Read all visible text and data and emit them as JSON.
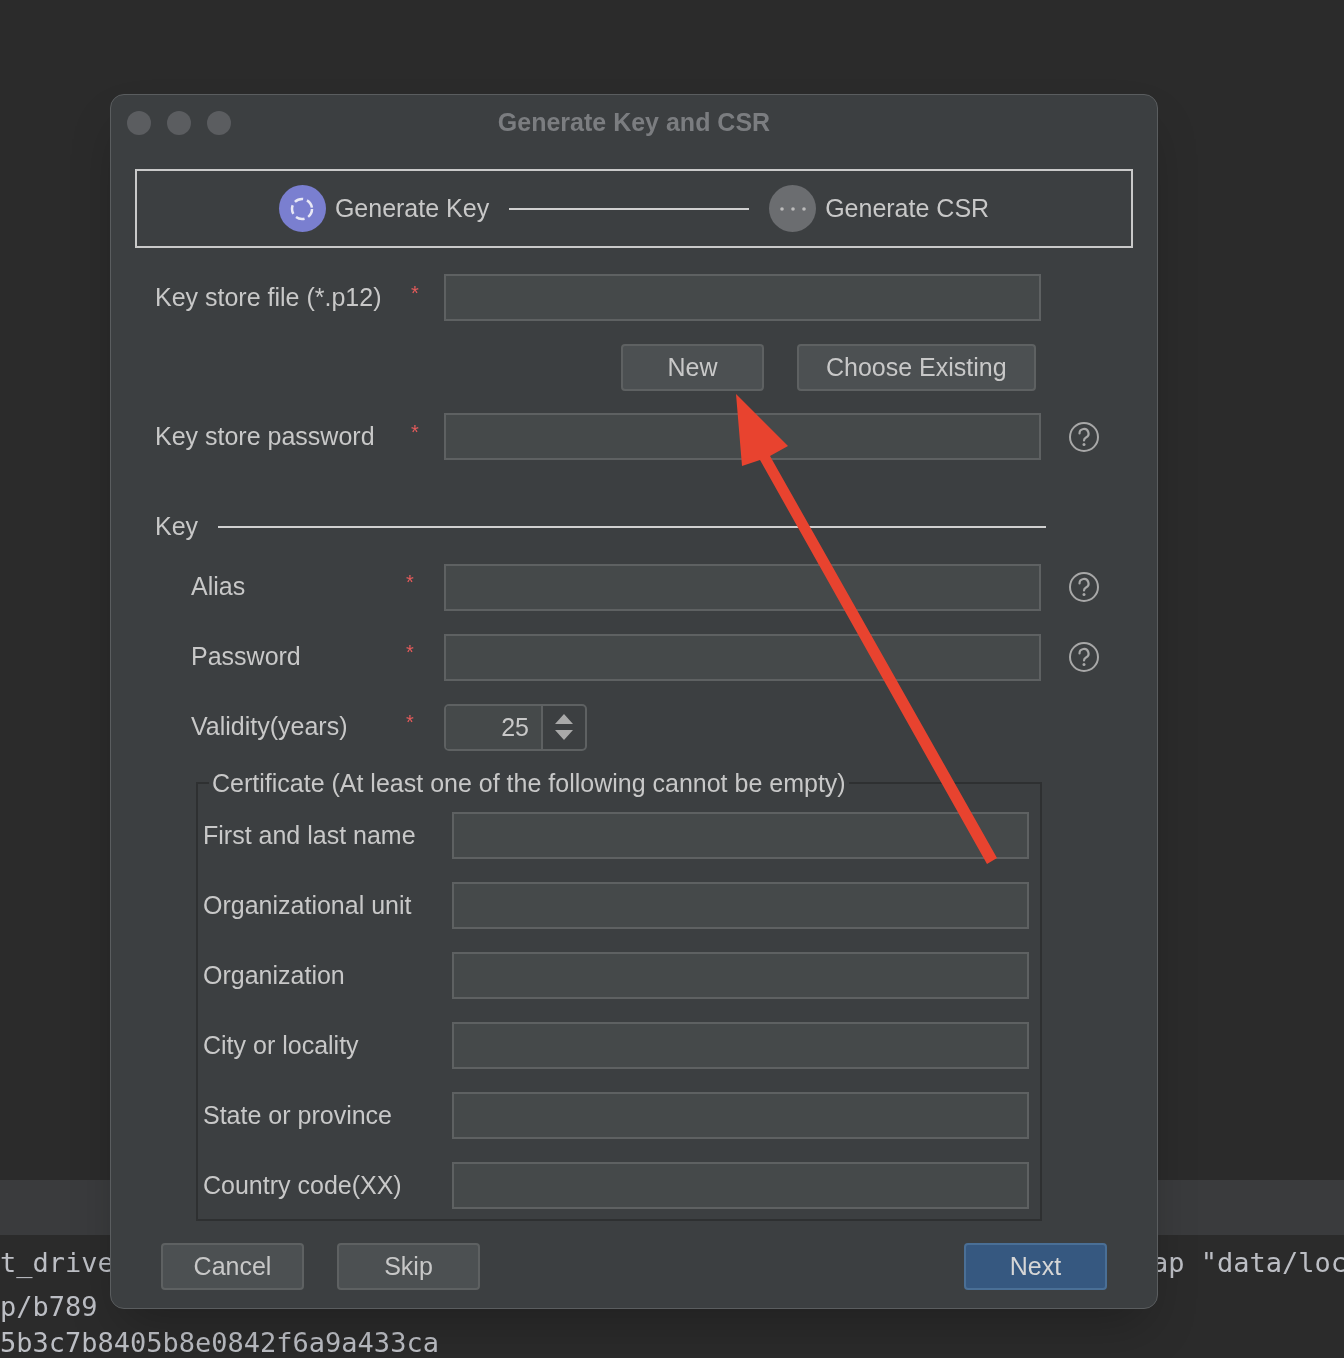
{
  "background_console": {
    "lines": [
      {
        "text": "t_drive"
      },
      {
        "text": "ap \"data/loc"
      },
      {
        "text": "p/b789"
      },
      {
        "text": "5b3c7b8405b8e0842f6a9a433ca"
      }
    ]
  },
  "window": {
    "title": "Generate Key and CSR"
  },
  "steps": [
    {
      "label": "Generate Key",
      "selected": true
    },
    {
      "label": "Generate CSR",
      "selected": false
    }
  ],
  "keystore": {
    "file_label": "Key store file (*.p12)",
    "required_mark": "*",
    "buttons": [
      "New",
      "Choose Existing"
    ],
    "password_label": "Key store password",
    "password_required_mark": "*"
  },
  "key_section": {
    "title": "Key",
    "fields": [
      {
        "label": "Alias",
        "required_mark": "*",
        "kind": "text",
        "help": true
      },
      {
        "label": "Password",
        "required_mark": "*",
        "kind": "text",
        "help": true
      },
      {
        "label": "Validity(years)",
        "required_mark": "*",
        "kind": "spinner",
        "value": "25",
        "help": false
      }
    ]
  },
  "certificate": {
    "legend": "Certificate (At least one of the following cannot be empty)",
    "fields": [
      "First and last name",
      "Organizational unit",
      "Organization",
      "City or locality",
      "State or province",
      "Country code(XX)"
    ]
  },
  "footer_buttons": [
    {
      "label": "Cancel",
      "primary": false
    },
    {
      "label": "Skip",
      "primary": false
    },
    {
      "label": "Next",
      "primary": true
    }
  ]
}
